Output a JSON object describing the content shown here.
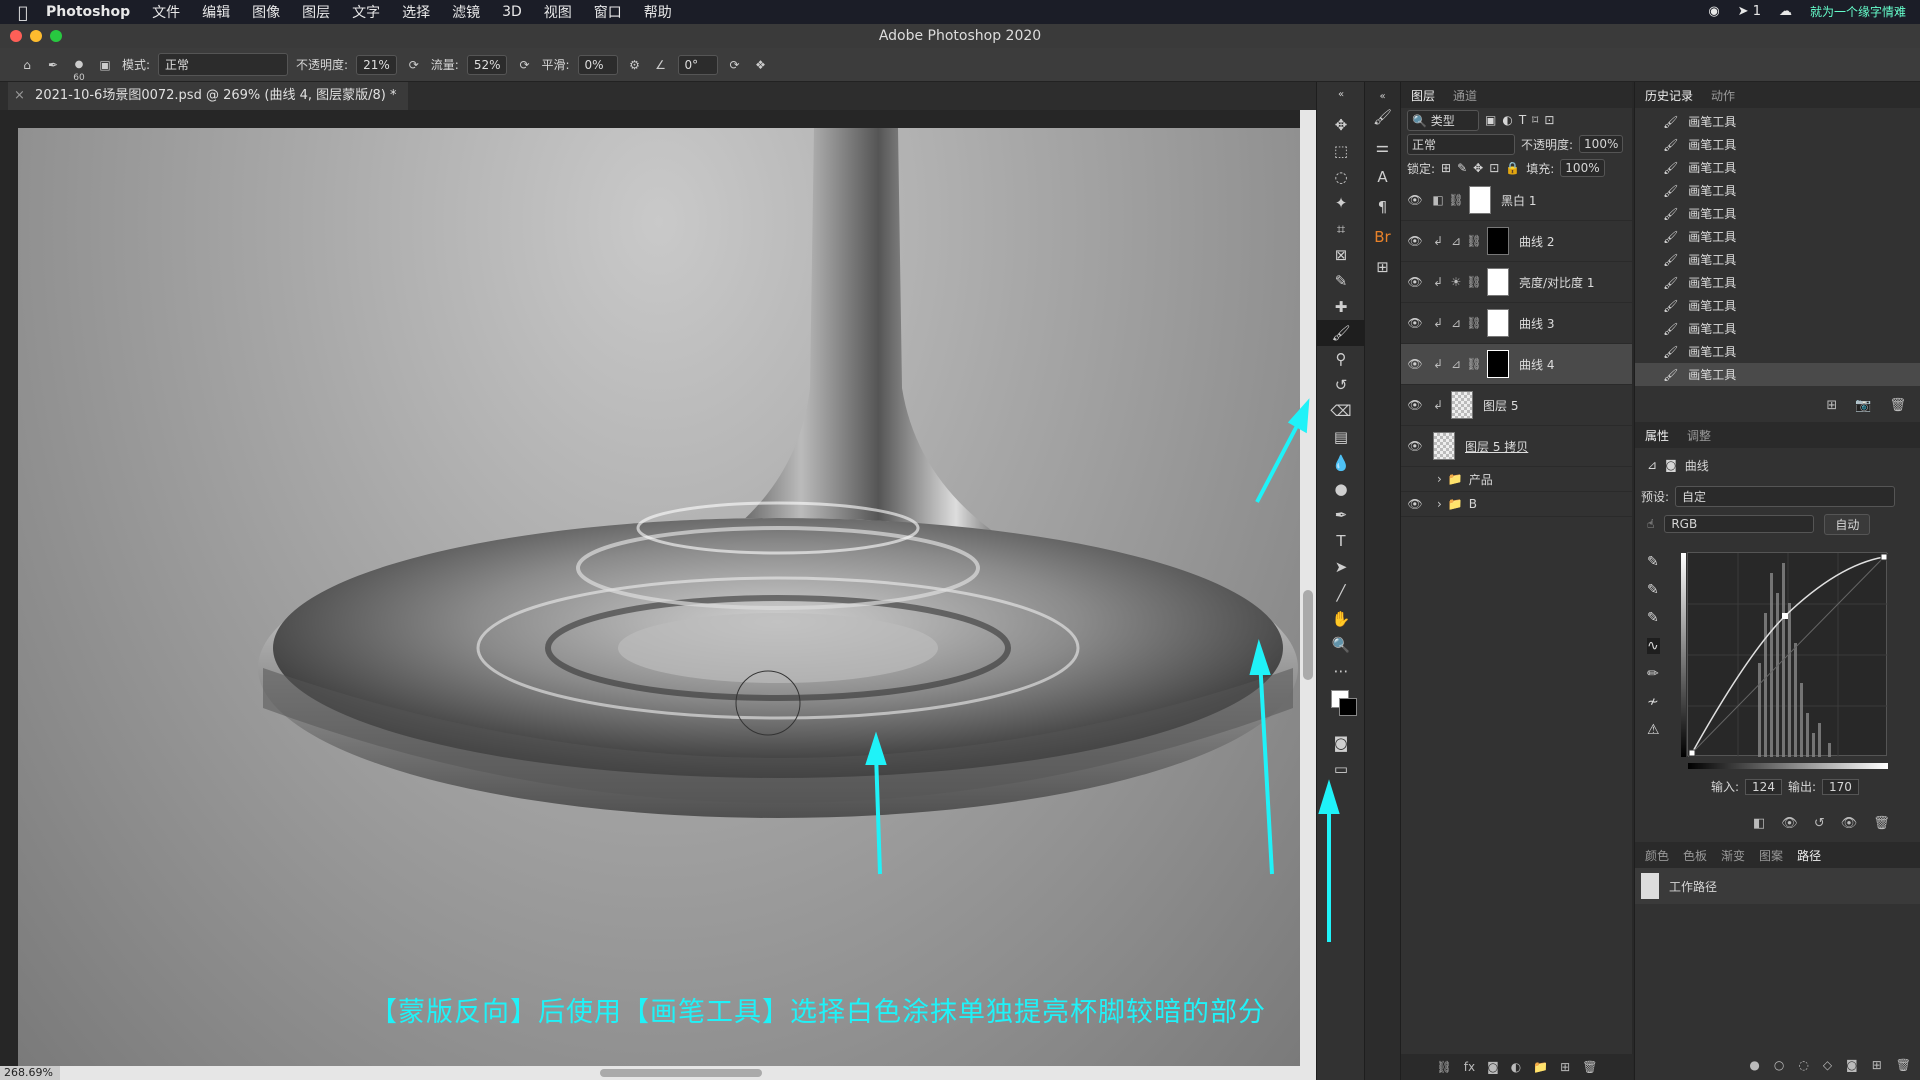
{
  "menubar": {
    "app": "Photoshop",
    "items": [
      "文件",
      "编辑",
      "图像",
      "图层",
      "文字",
      "选择",
      "滤镜",
      "3D",
      "视图",
      "窗口",
      "帮助"
    ],
    "badge": "1",
    "watermark": "就为一个缘字情难"
  },
  "window": {
    "title": "Adobe Photoshop 2020"
  },
  "options": {
    "brush_size": "60",
    "mode_label": "模式:",
    "mode_value": "正常",
    "opacity_label": "不透明度:",
    "opacity_value": "21%",
    "flow_label": "流量:",
    "flow_value": "52%",
    "smooth_label": "平滑:",
    "smooth_value": "0%",
    "angle_value": "0°"
  },
  "document": {
    "tab_title": "2021-10-6场景图0072.psd @ 269% (曲线 4, 图层蒙版/8) *",
    "zoom": "268.69%"
  },
  "caption": "【蒙版反向】后使用【画笔工具】选择白色涂抹单独提亮杯脚较暗的部分",
  "layers_panel": {
    "tabs": [
      "图层",
      "通道"
    ],
    "filter_label": "类型",
    "blend_mode": "正常",
    "opacity_label": "不透明度:",
    "opacity_value": "100%",
    "lock_label": "锁定:",
    "fill_label": "填充:",
    "fill_value": "100%",
    "layers": [
      {
        "name": "黑白 1",
        "mask": "white"
      },
      {
        "name": "曲线 2",
        "mask": "black"
      },
      {
        "name": "亮度/对比度 1",
        "mask": "white"
      },
      {
        "name": "曲线 3",
        "mask": "white"
      },
      {
        "name": "曲线 4",
        "mask": "black",
        "selected": true
      },
      {
        "name": "图层 5",
        "mask": "checker"
      },
      {
        "name": "图层 5 拷贝",
        "mask": "checker"
      }
    ],
    "groups": [
      "产品",
      "B"
    ]
  },
  "history_panel": {
    "tabs": [
      "历史记录",
      "动作"
    ],
    "items": [
      "画笔工具",
      "画笔工具",
      "画笔工具",
      "画笔工具",
      "画笔工具",
      "画笔工具",
      "画笔工具",
      "画笔工具",
      "画笔工具",
      "画笔工具",
      "画笔工具",
      "画笔工具"
    ]
  },
  "properties_panel": {
    "tabs": [
      "属性",
      "调整"
    ],
    "type_label": "曲线",
    "preset_label": "预设:",
    "preset_value": "自定",
    "channel": "RGB",
    "auto_label": "自动",
    "input_label": "输入:",
    "input_value": "124",
    "output_label": "输出:",
    "output_value": "170"
  },
  "bottom_panel": {
    "tabs": [
      "颜色",
      "色板",
      "渐变",
      "图案",
      "路径"
    ],
    "path_item": "工作路径"
  }
}
